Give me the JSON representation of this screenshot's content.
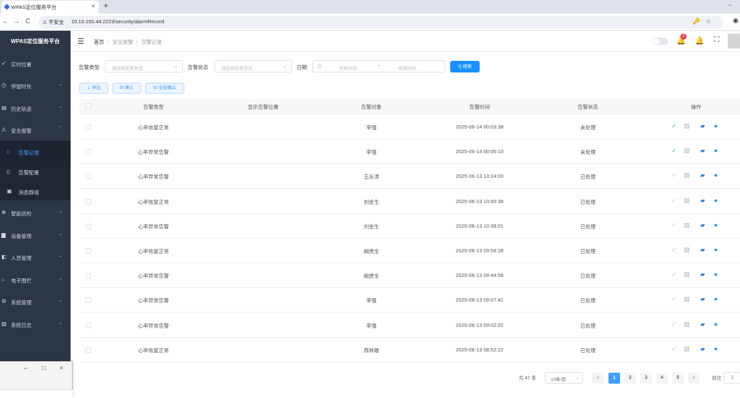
{
  "browser": {
    "tab_title": "WPAS定位服务平台",
    "tab_close": "×",
    "new_tab": "+",
    "insecure_label": "不安全",
    "url": "10.10.150.44:2223/security/alarmRecord",
    "nav_back": "←",
    "nav_forward": "→",
    "nav_reload": "C",
    "window_min": "–",
    "window_max": "□",
    "right_icons": "🔑☆",
    "profile": "◉"
  },
  "sidebar": {
    "logo": "WPAS定位服务平台",
    "items": [
      {
        "label": "实时位置",
        "icon": "➶",
        "chevron": ""
      },
      {
        "label": "停留时长",
        "icon": "◷",
        "chevron": "⌄"
      },
      {
        "label": "历史轨迹",
        "icon": "▤",
        "chevron": "⌄"
      },
      {
        "label": "安全报警",
        "icon": "⚠",
        "chevron": "⌃"
      },
      {
        "label": "告警记录",
        "icon": "▯",
        "chevron": ""
      },
      {
        "label": "告警配置",
        "icon": "▯",
        "chevron": ""
      },
      {
        "label": "消息群组",
        "icon": "▣",
        "chevron": ""
      },
      {
        "label": "智能巡检",
        "icon": "⊕",
        "chevron": "⌄"
      },
      {
        "label": "设备管理",
        "icon": "▆",
        "chevron": "⌄"
      },
      {
        "label": "人员管理",
        "icon": "◧",
        "chevron": "⌄"
      },
      {
        "label": "电子围栏",
        "icon": "⌂",
        "chevron": "⌄"
      },
      {
        "label": "系统管理",
        "icon": "⚙",
        "chevron": "⌄"
      },
      {
        "label": "系统日志",
        "icon": "▧",
        "chevron": "⌄"
      }
    ]
  },
  "header": {
    "menu_icon": "☰",
    "breadcrumb": {
      "home": "首页",
      "section": "安全报警",
      "page": "告警记录",
      "sep": "/"
    },
    "notification_count": "2",
    "bell_icon": "🔔",
    "fullscreen_icon": "⛶"
  },
  "filters": {
    "type_label": "告警类型",
    "type_placeholder": "请选择告警类型",
    "status_label": "告警状态",
    "status_placeholder": "请选择告警状态",
    "date_label": "日期",
    "date_start": "开始时间",
    "date_sep": "-",
    "date_end": "结束时间",
    "search_button": "Q 搜索",
    "dropdown_arrow": "⌄",
    "calendar_icon": "◷"
  },
  "actions": {
    "export": "⇣ 导出",
    "confirm": "⊟ 确认",
    "confirm_all": "⊟ 全部确认"
  },
  "table": {
    "columns": [
      "告警类型",
      "显示告警位置",
      "告警对象",
      "告警时间",
      "告警状态",
      "操作"
    ],
    "rows": [
      {
        "type": "心率恢复正常",
        "location": "",
        "target": "李强",
        "time": "2025-06-14 00:03:38",
        "status": "未处理",
        "confirm_active": true
      },
      {
        "type": "心率异常告警",
        "location": "",
        "target": "李强",
        "time": "2025-06-14 00:00:10",
        "status": "未处理",
        "confirm_active": true
      },
      {
        "type": "心率异常告警",
        "location": "",
        "target": "王永涛",
        "time": "2025-06-13 13:24:00",
        "status": "已处理",
        "confirm_active": false
      },
      {
        "type": "心率恢复正常",
        "location": "",
        "target": "刘金生",
        "time": "2025-06-13 10:40:38",
        "status": "已处理",
        "confirm_active": false
      },
      {
        "type": "心率异常告警",
        "location": "",
        "target": "刘金生",
        "time": "2025-06-13 10:39:01",
        "status": "已处理",
        "confirm_active": false
      },
      {
        "type": "心率恢复正常",
        "location": "",
        "target": "阚虎全",
        "time": "2025-06-13 09:58:28",
        "status": "已处理",
        "confirm_active": false
      },
      {
        "type": "心率异常告警",
        "location": "",
        "target": "阚虎全",
        "time": "2025-06-13 09:44:58",
        "status": "已处理",
        "confirm_active": false
      },
      {
        "type": "心率异常告警",
        "location": "",
        "target": "李强",
        "time": "2025-06-13 09:07:41",
        "status": "已处理",
        "confirm_active": false
      },
      {
        "type": "心率异常告警",
        "location": "",
        "target": "李强",
        "time": "2025-06-13 09:02:02",
        "status": "已处理",
        "confirm_active": false
      },
      {
        "type": "心率恢复正常",
        "location": "",
        "target": "燕林雄",
        "time": "2025-06-13 08:52:22",
        "status": "已处理",
        "confirm_active": false
      }
    ],
    "op_icons": {
      "confirm": "✓",
      "image": "▨",
      "map": "▰",
      "locate": "●"
    }
  },
  "pagination": {
    "total": "共 47 条",
    "page_size": "10条/页",
    "prev": "‹",
    "next": "›",
    "pages": [
      "1",
      "2",
      "3",
      "4",
      "5"
    ],
    "current": "1",
    "goto_label": "前往",
    "goto_value": "1"
  },
  "colors": {
    "sidebar_bg": "#2c3645",
    "primary": "#409eff",
    "alert_red": "#e5484d"
  }
}
